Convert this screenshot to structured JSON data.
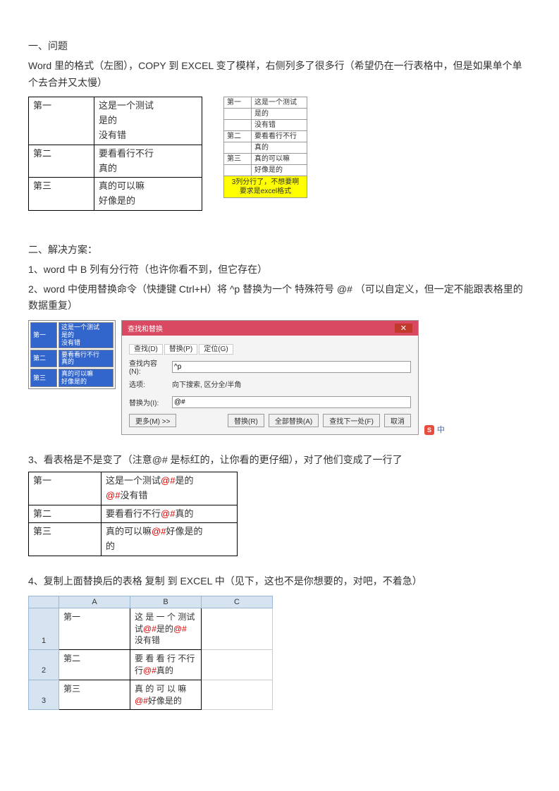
{
  "s1": {
    "title": "一、问题",
    "desc": "Word 里的格式（左图），COPY 到 EXCEL 变了模样，右侧列多了很多行（希望仍在一行表格中，但是如果单个单个去合并又太慢）",
    "left": {
      "r1c1": "第一",
      "r1c2": "这是一个测试\n是的\n没有错",
      "r2c1": "第二",
      "r2c2": "要看看行不行\n真的",
      "r3c1": "第三",
      "r3c2": "真的可以嘛\n好像是的"
    },
    "right": {
      "r1": "第一",
      "r1b": "这是一个测试",
      "r2b": "是的",
      "r3b": "没有错",
      "r4": "第二",
      "r4b": "要看看行不行",
      "r5b": "真的",
      "r6": "第三",
      "r6b": "真的可以嘛",
      "r7b": "好像是的",
      "note": "3列分行了，不想要啊\n要求是excel格式"
    }
  },
  "s2": {
    "title": "二、解决方案：",
    "step1": "1、word 中 B 列有分行符（也许你看不到，但它存在）",
    "step2": "2、word 中使用替换命令（快捷键  Ctrl+H）将  ^p 替换为一个 特殊符号 @#  （可以自定义，但一定不能跟表格里的数据重复）",
    "mini": {
      "r1a": "第一",
      "r1b": "这是一个测试\n是的\n没有错",
      "r2a": "第二",
      "r2b": "要看看行不行\n真的",
      "r3a": "第三",
      "r3b": "真的可以嘛\n好像是的"
    },
    "dialog": {
      "title": "查找和替换",
      "tab1": "查找(D)",
      "tab2": "替换(P)",
      "tab3": "定位(G)",
      "findLabel": "查找内容(N):",
      "findVal": "^p",
      "optLabel": "选项:",
      "optVal": "向下搜索, 区分全/半角",
      "repLabel": "替换为(I):",
      "repVal": "@#",
      "btnMore": "更多(M) >>",
      "btnRep": "替换(R)",
      "btnAll": "全部替换(A)",
      "btnNext": "查找下一处(F)",
      "btnCancel": "取消"
    }
  },
  "s3": {
    "title": "3、看表格是不是变了（注意@# 是标红的，让你看的更仔细），对了他们变成了一行了",
    "tbl": {
      "r1a": "第一",
      "r1b_p1": "这是一个测试",
      "r1b_m1": "@#",
      "r1b_p2": "是的",
      "r1b_m2": "@#",
      "r1b_p3": "没有错",
      "r2a": "第二",
      "r2b_p1": "要看看行不行",
      "r2b_m1": "@#",
      "r2b_p2": "真的",
      "r3a": "第三",
      "r3b_p1": "真的可以嘛",
      "r3b_m1": "@#",
      "r3b_p2": "好像是的"
    }
  },
  "s4": {
    "title": "4、复制上面替换后的表格 复制 到 EXCEL 中（见下，这也不是你想要的，对吧，不着急）",
    "cols": {
      "a": "A",
      "b": "B",
      "c": "C"
    },
    "rows": {
      "n1": "1",
      "n2": "2",
      "n3": "3",
      "r1a": "第一",
      "r1b_1": "这 是 一 个 测试",
      "r1b_m1": "@#",
      "r1b_2": "是的",
      "r1b_m2": "@#",
      "r1b_3": "没有错",
      "r2a": "第二",
      "r2b_1": "要 看 看 行 不行",
      "r2b_m1": "@#",
      "r2b_2": "真的",
      "r3a": "第三",
      "r3b_1": "真 的 可 以 嘛",
      "r3b_m1": "@#",
      "r3b_2": "好像是的"
    }
  }
}
